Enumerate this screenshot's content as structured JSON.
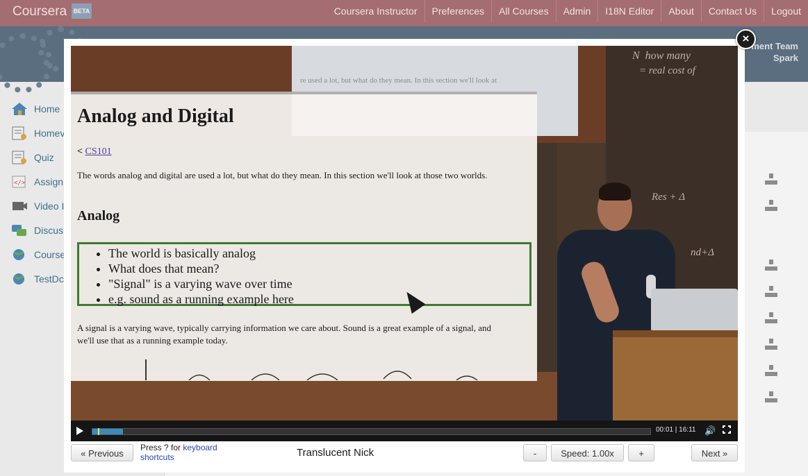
{
  "topbar": {
    "brand": "Coursera",
    "beta": "BETA",
    "nav": [
      "Coursera Instructor",
      "Preferences",
      "All Courses",
      "Admin",
      "I18N Editor",
      "About",
      "Contact Us",
      "Logout"
    ]
  },
  "banner": {
    "team_line1": "ment Team",
    "team_line2": "Spark"
  },
  "sidebar": {
    "items": [
      {
        "label": "Home",
        "icon": "house-icon"
      },
      {
        "label": "Homev",
        "icon": "homework-icon"
      },
      {
        "label": "Quiz",
        "icon": "quiz-icon"
      },
      {
        "label": "Assign",
        "icon": "code-icon"
      },
      {
        "label": "Video I",
        "icon": "video-icon"
      },
      {
        "label": "Discus",
        "icon": "discussion-icon"
      },
      {
        "label": "Course",
        "icon": "globe-icon"
      },
      {
        "label": "TestDc",
        "icon": "globe-icon"
      }
    ]
  },
  "modal": {
    "close_label": "×",
    "slide": {
      "title": "Analog and Digital",
      "back_prefix": "< ",
      "back_link": "CS101",
      "intro": "The words analog and digital are used a lot, but what do they mean. In this section we'll look at those two worlds.",
      "heading": "Analog",
      "bullets": [
        "The world is basically analog",
        "What does that mean?",
        "\"Signal\" is a varying wave over time",
        "e.g. sound as a running example here"
      ],
      "para": "A signal is a varying wave, typically carrying information we care about. Sound is a great example of a signal, and we'll use that as a running example today.",
      "screen_text": "re used a lot, but what do they mean. In this section we'll look at"
    },
    "player": {
      "time": "00:01 | 16:11",
      "progress": 0.05,
      "buffered": 0.055
    },
    "footer": {
      "prev_label": "« Previous",
      "shortcuts_prefix": "Press ? for ",
      "shortcuts_link1": "keyboard",
      "shortcuts_link2": "shortcuts",
      "video_title": "Translucent Nick",
      "speed_minus": "-",
      "speed_label": "Speed: 1.00x",
      "speed_plus": "+",
      "next_label": "Next »"
    }
  }
}
